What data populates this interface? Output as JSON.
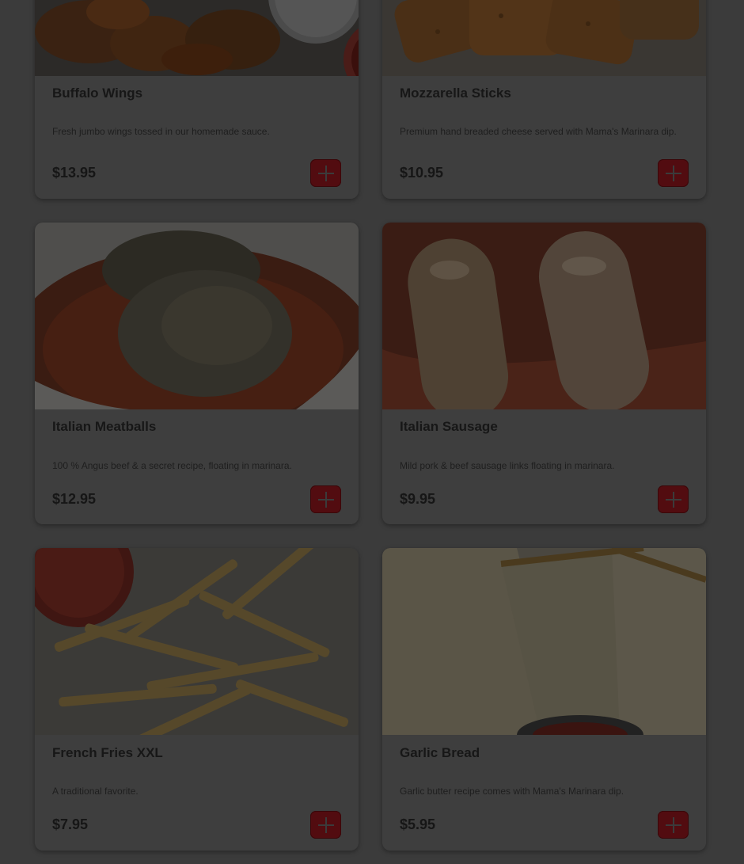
{
  "menu": {
    "items": [
      {
        "name": "Buffalo Wings",
        "description": "Fresh jumbo wings tossed in our homemade sauce.",
        "price": "$13.95",
        "image": "buffalo-wings-photo"
      },
      {
        "name": "Mozzarella Sticks",
        "description": "Premium hand breaded cheese served with Mama's Marinara dip.",
        "price": "$10.95",
        "image": "mozzarella-sticks-photo"
      },
      {
        "name": "Italian Meatballs",
        "description": "100 % Angus beef & a secret recipe, floating in marinara.",
        "price": "$12.95",
        "image": "italian-meatballs-photo"
      },
      {
        "name": "Italian Sausage",
        "description": "Mild pork & beef sausage links floating in marinara.",
        "price": "$9.95",
        "image": "italian-sausage-photo"
      },
      {
        "name": "French Fries XXL",
        "description": "A traditional favorite.",
        "price": "$7.95",
        "image": "french-fries-photo"
      },
      {
        "name": "Garlic Bread",
        "description": "Garlic butter recipe comes with Mama's Marinara dip.",
        "price": "$5.95",
        "image": "garlic-bread-photo"
      }
    ],
    "add_button_icon": "plus-icon"
  },
  "colors": {
    "page_background": "#3b3b3b",
    "card_background": "#3e3e3e",
    "add_button": "#520c10",
    "text": "#171717"
  }
}
